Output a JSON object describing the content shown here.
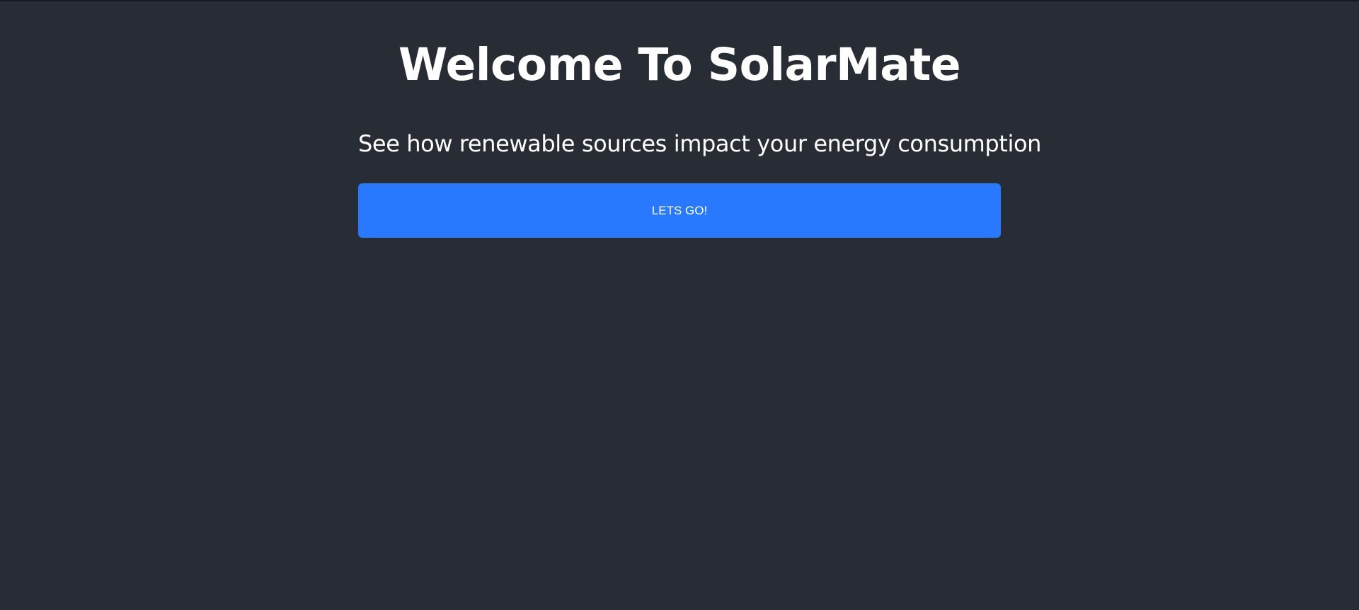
{
  "page": {
    "title": "Welcome To SolarMate",
    "subtitle": "See how renewable sources impact your energy consumption",
    "cta_label": "LETS GO!"
  },
  "colors": {
    "background": "#282c34",
    "text": "#ffffff",
    "accent": "#2979ff"
  }
}
